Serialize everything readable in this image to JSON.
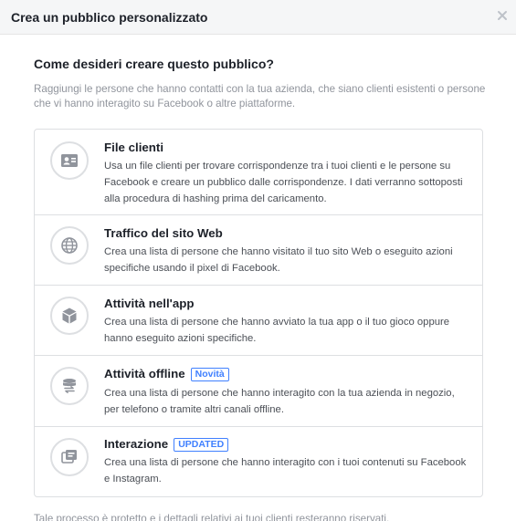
{
  "dialog": {
    "title": "Crea un pubblico personalizzato",
    "close_symbol": "×"
  },
  "question": "Come desideri creare questo pubblico?",
  "intro": "Raggiungi le persone che hanno contatti con la tua azienda, che siano clienti esistenti o persone che vi hanno interagito su Facebook o altre piattaforme.",
  "options": [
    {
      "title": "File clienti",
      "icon": "contact-card-icon",
      "description": "Usa un file clienti per trovare corrispondenze tra i tuoi clienti e le persone su Facebook e creare un pubblico dalle corrispondenze. I dati verranno sottoposti alla procedura di hashing prima del caricamento."
    },
    {
      "title": "Traffico del sito Web",
      "icon": "globe-icon",
      "description": "Crea una lista di persone che hanno visitato il tuo sito Web o eseguito azioni specifiche usando il pixel di Facebook."
    },
    {
      "title": "Attività nell'app",
      "icon": "cube-icon",
      "description": "Crea una lista di persone che hanno avviato la tua app o il tuo gioco oppure hanno eseguito azioni specifiche."
    },
    {
      "title": "Attività offline",
      "icon": "database-sync-icon",
      "badge": "Novità",
      "description": "Crea una lista di persone che hanno interagito con la tua azienda in negozio, per telefono o tramite altri canali offline."
    },
    {
      "title": "Interazione",
      "icon": "engagement-pages-icon",
      "badge": "UPDATED",
      "description": "Crea una lista di persone che hanno interagito con i tuoi contenuti su Facebook e Instagram."
    }
  ],
  "footer_note": "Tale processo è protetto e i dettagli relativi ai tuoi clienti resteranno riservati.",
  "colors": {
    "header_bg": "#f5f6f7",
    "border": "#dddfe2",
    "icon_gray": "#90949c",
    "badge_blue": "#4080ff",
    "text_dark": "#1d2129",
    "text_muted": "#90949c"
  }
}
